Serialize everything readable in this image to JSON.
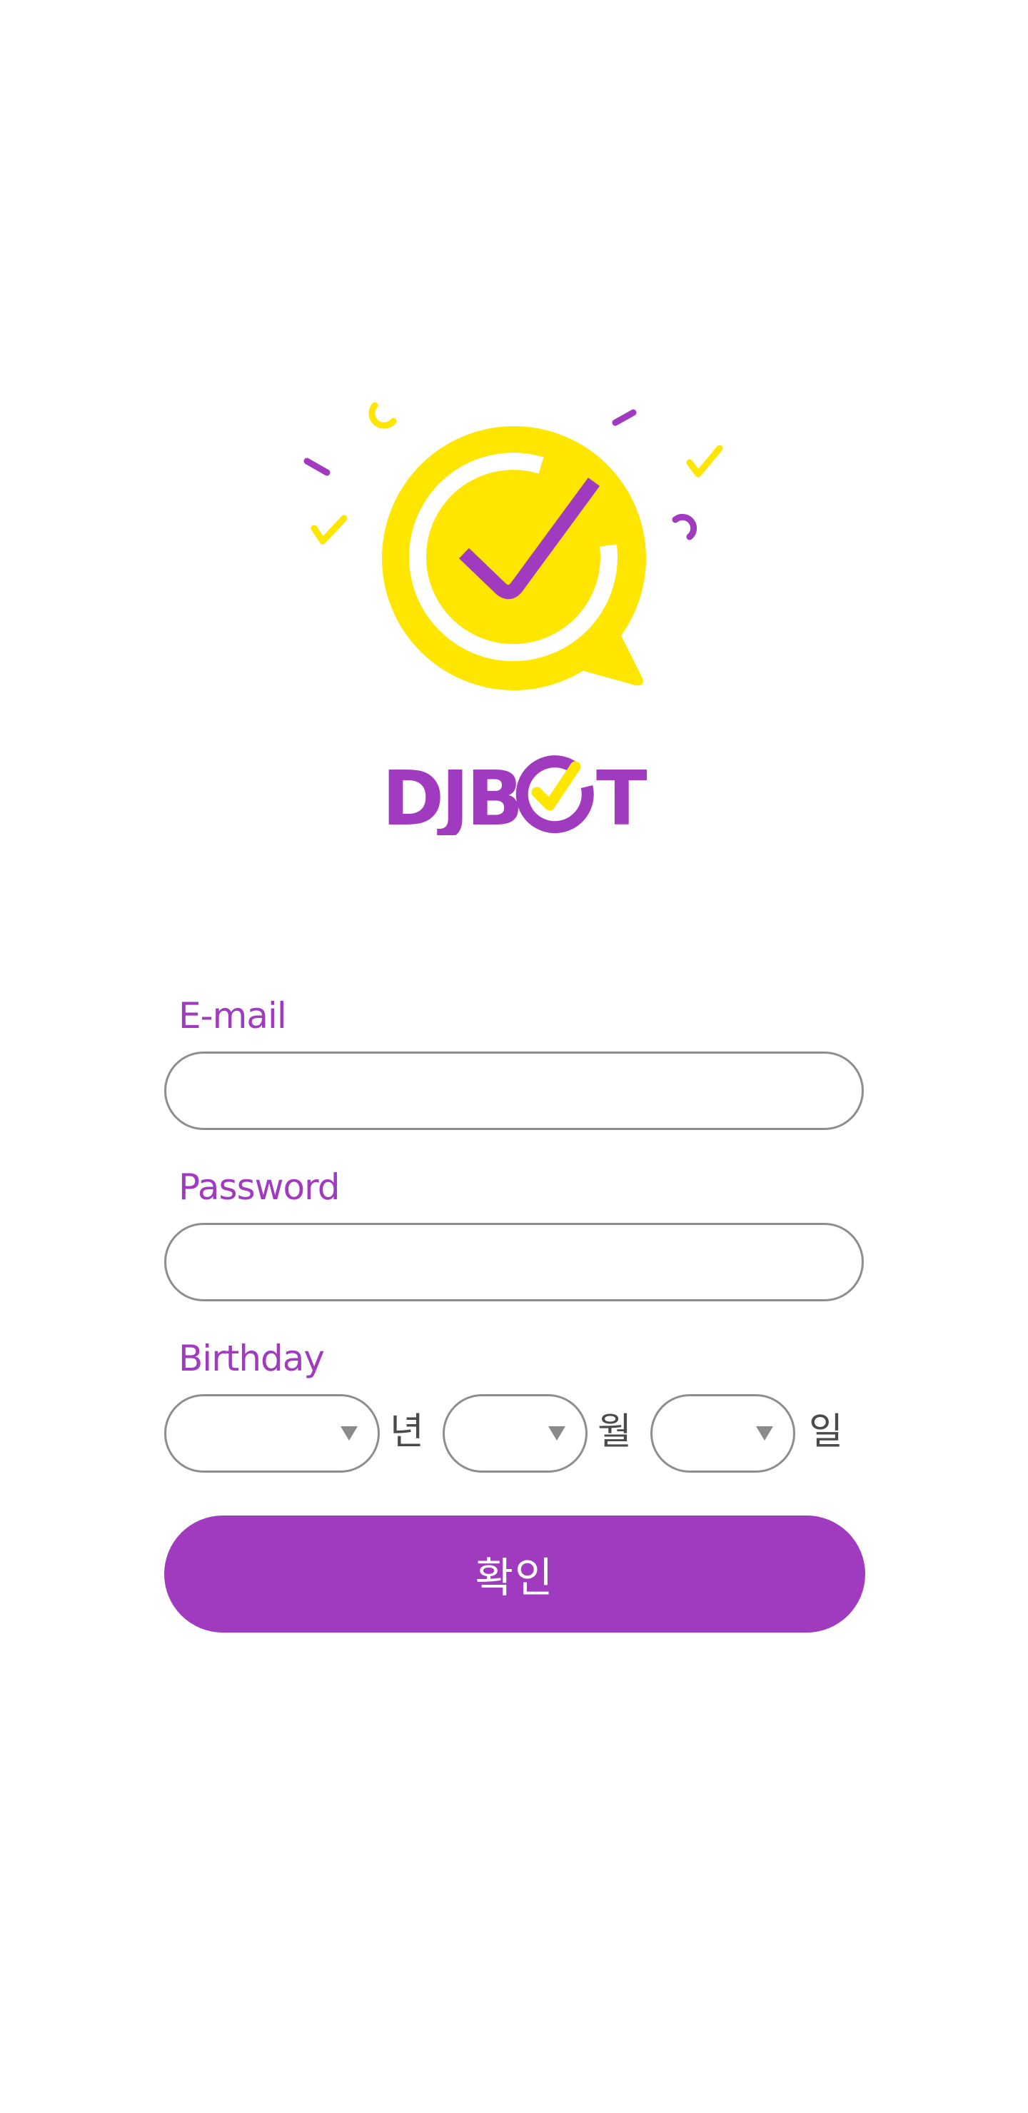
{
  "brand": {
    "wordmark_prefix": "DJB",
    "wordmark_suffix": "T",
    "colors": {
      "primary": "#a03abe",
      "accent": "#ffe600",
      "input_border": "#8e8e8e",
      "unit_text": "#4a4a4a"
    },
    "icon": "chat-bubble-checkmark-icon"
  },
  "form": {
    "email": {
      "label": "E-mail",
      "value": "",
      "placeholder": ""
    },
    "password": {
      "label": "Password",
      "value": "",
      "placeholder": ""
    },
    "birthday": {
      "label": "Birthday",
      "year": {
        "value": "",
        "unit": "년"
      },
      "month": {
        "value": "",
        "unit": "월"
      },
      "day": {
        "value": "",
        "unit": "일"
      }
    },
    "submit_label": "확인"
  }
}
